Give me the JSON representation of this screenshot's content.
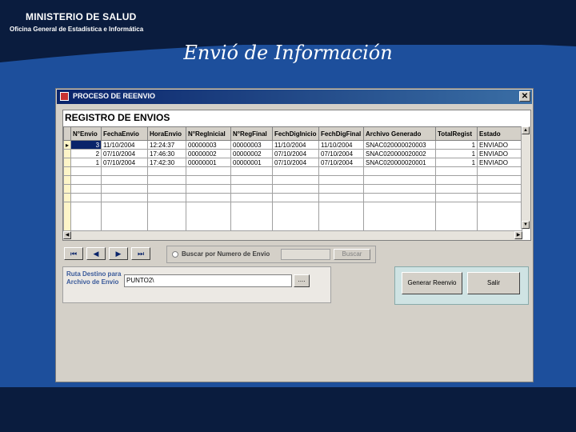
{
  "slide": {
    "org_title": "MINISTERIO DE SALUD",
    "org_subtitle": "Oficina General de Estadística e Informática",
    "title": "Envió de Información"
  },
  "window": {
    "title": "PROCESO DE REENVIO",
    "close_label": "✕",
    "grid_caption": "REGISTRO DE ENVIOS",
    "columns": [
      "N°Envio",
      "FechaEnvio",
      "HoraEnvio",
      "N°RegInicial",
      "N°RegFinal",
      "FechDigInicio",
      "FechDigFinal",
      "Archivo Generado",
      "TotalRegist",
      "Estado"
    ],
    "rows": [
      [
        "3",
        "11/10/2004",
        "12:24:37",
        "00000003",
        "00000003",
        "11/10/2004",
        "11/10/2004",
        "SNAC020000020003",
        "1",
        "ENVIADO"
      ],
      [
        "2",
        "07/10/2004",
        "17:46:30",
        "00000002",
        "00000002",
        "07/10/2004",
        "07/10/2004",
        "SNAC020000020002",
        "1",
        "ENVIADO"
      ],
      [
        "1",
        "07/10/2004",
        "17:42:30",
        "00000001",
        "00000001",
        "07/10/2004",
        "07/10/2004",
        "SNAC020000020001",
        "1",
        "ENVIADO"
      ]
    ],
    "nav": {
      "first": "⏮",
      "prev": "◀",
      "next": "▶",
      "last": "⏭"
    },
    "search": {
      "label": "Buscar por Numero de Envio",
      "button": "Buscar",
      "value": ""
    },
    "destination": {
      "label": "Ruta Destino para Archivo de Envio",
      "value": "PUNTO2\\",
      "browse": "...."
    },
    "actions": {
      "generate": "Generar Reenvio",
      "exit": "Salir"
    }
  },
  "colors": {
    "header_band": "#0a1c3e",
    "slide_bg": "#1d4f9c",
    "titlebar": "#0a246a"
  }
}
